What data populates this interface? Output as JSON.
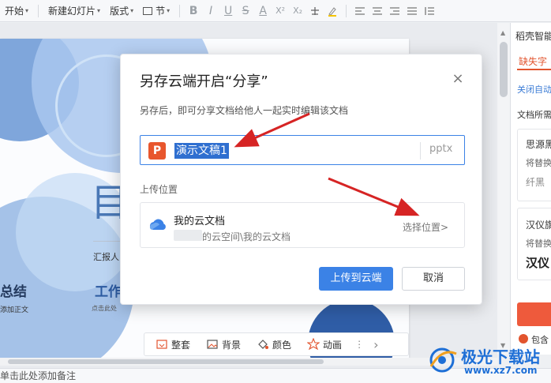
{
  "toolbar": {
    "items": [
      {
        "label": "开始",
        "caret": "▾"
      },
      {
        "label": "新建幻灯片",
        "caret": "▾"
      },
      {
        "label": "版式",
        "caret": "▾"
      },
      {
        "label": "节",
        "caret": "▾"
      }
    ],
    "format_icons": [
      "B",
      "I",
      "U",
      "S",
      "A",
      "X²",
      "X₂"
    ]
  },
  "slide": {
    "title_char": "目",
    "reporter_label": "汇报人",
    "summary_title": "总结",
    "summary_sub": "添加正文",
    "work_title": "工作",
    "work_sub": "点击此处"
  },
  "slide_toolbar": {
    "buttons": [
      {
        "label": "整套",
        "icon": "template-icon"
      },
      {
        "label": "背景",
        "icon": "background-icon"
      },
      {
        "label": "颜色",
        "icon": "paint-bucket-icon"
      },
      {
        "label": "动画",
        "icon": "star-icon"
      }
    ],
    "more": "⋮",
    "next": "›"
  },
  "right_panel": {
    "title": "稻壳智能",
    "tab": "缺失字",
    "link": "关闭自动",
    "label": "文档所需",
    "card1": {
      "name": "思源黑",
      "replace": "将替换",
      "sample": "纤黑"
    },
    "card2": {
      "name": "汉仪旗",
      "replace": "将替换",
      "sample": "汉仪"
    },
    "footer": "包含"
  },
  "notes_bar": {
    "text": "单击此处添加备注"
  },
  "dialog": {
    "title": "另存云端开启“分享”",
    "close_icon": "×",
    "description": "另存后，即可分享文档给他人一起实时编辑该文档",
    "file_icon_letter": "P",
    "file_name": "演示文稿1",
    "file_ext": "pptx",
    "upload_label": "上传位置",
    "location": {
      "name": "我的云文档",
      "path": "的云空间\\我的云文档",
      "choose": "选择位置>"
    },
    "upload_button": "上传到云端",
    "cancel_button": "取消"
  },
  "watermark": {
    "title": "极光下载站",
    "url": "www.xz7.com"
  },
  "colors": {
    "accent": "#3b82e6",
    "ppt_orange": "#e8562d",
    "arrow_red": "#d62424"
  }
}
